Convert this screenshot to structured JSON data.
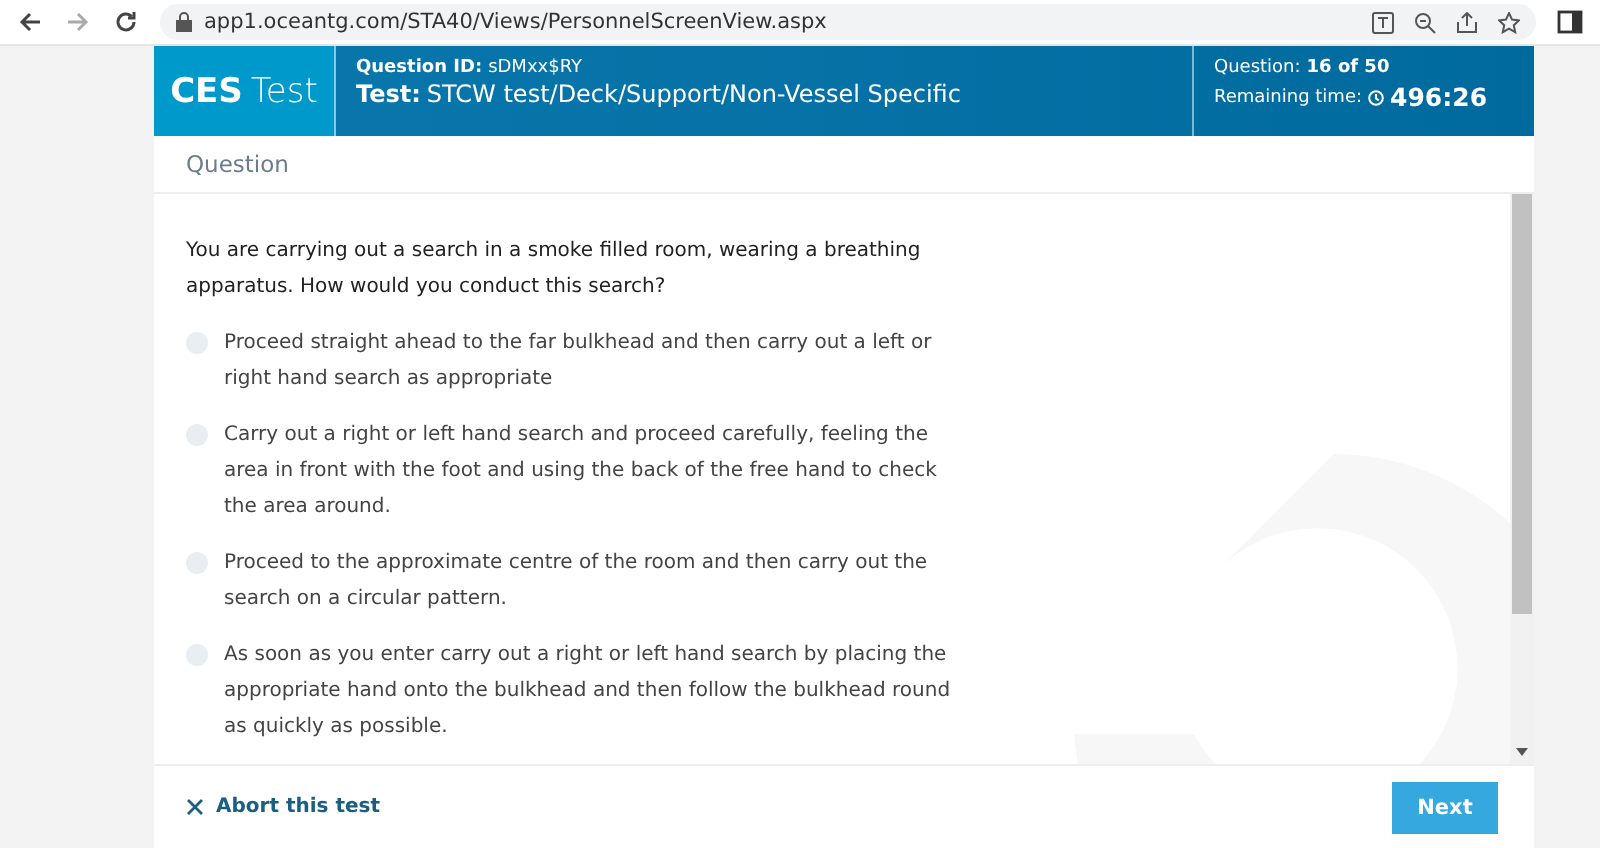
{
  "browser": {
    "url": "app1.oceantg.com/STA40/Views/PersonnelScreenView.aspx"
  },
  "header": {
    "brand_bold": "CES",
    "brand_light": "Test",
    "question_id_label": "Question ID:",
    "question_id": "sDMxx$RY",
    "test_label": "Test:",
    "test_name": "STCW test/Deck/Support/Non-Vessel Specific",
    "progress_label": "Question:",
    "progress": "16 of 50",
    "time_label": "Remaining time:",
    "time": "496:26"
  },
  "section_title": "Question",
  "question": "You are carrying out a search in a smoke filled room, wearing a breathing apparatus. How would you conduct this search?",
  "options": [
    {
      "text": "Proceed straight ahead to the far bulkhead and then carry out a left or right hand search as appropriate",
      "selected": false
    },
    {
      "text": "Carry out a right or left hand search and proceed carefully, feeling the area in front with the foot and using the back of the free hand to check the area around.",
      "selected": false
    },
    {
      "text": "Proceed to the approximate centre of the room and then carry out the search on a circular pattern.",
      "selected": false
    },
    {
      "text": "As soon as you enter carry out a right or left hand search by placing the appropriate hand onto the bulkhead and then follow the bulkhead round as quickly as possible.",
      "selected": false
    }
  ],
  "footer": {
    "abort": "Abort this test",
    "next": "Next"
  }
}
